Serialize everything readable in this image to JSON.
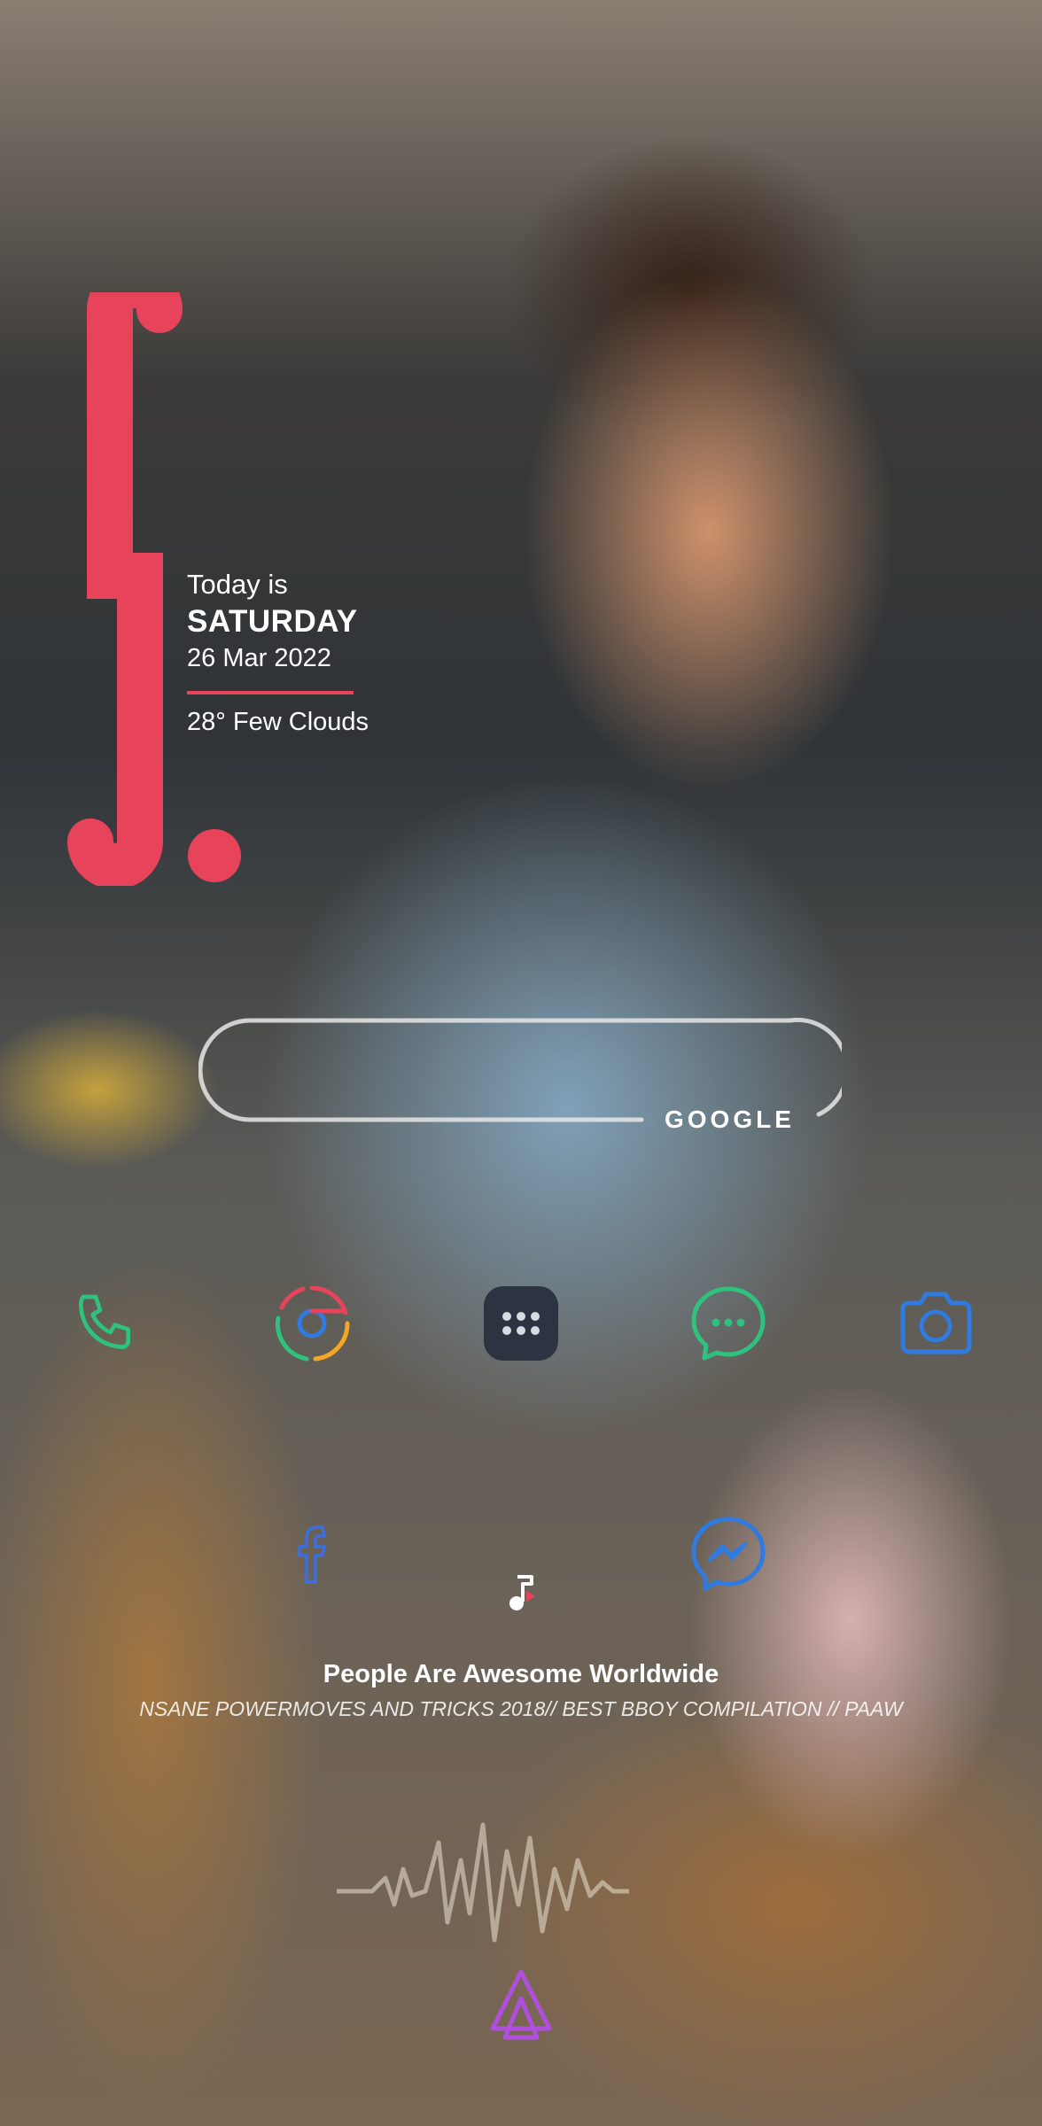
{
  "clock_widget": {
    "logo_letter": "S",
    "today_label": "Today is",
    "day_name": "SATURDAY",
    "date": "26 Mar 2022",
    "weather": "28° Few Clouds"
  },
  "search": {
    "label": "GOOGLE"
  },
  "dock": {
    "row1": [
      {
        "name": "phone-icon",
        "color": "#2ec27e"
      },
      {
        "name": "chrome-icon",
        "color": "#e7435a"
      },
      {
        "name": "app-drawer-icon",
        "color": "#2b3440"
      },
      {
        "name": "messages-icon",
        "color": "#2ec27e"
      },
      {
        "name": "camera-icon",
        "color": "#2f7be0"
      }
    ],
    "row2": [
      {
        "name": "facebook-icon",
        "color": "#3b6fe0"
      },
      {
        "name": "music-icon",
        "color": "#ffffff"
      },
      {
        "name": "messenger-icon",
        "color": "#2f7be0"
      }
    ]
  },
  "media": {
    "title": "People Are Awesome Worldwide",
    "subtitle": "NSANE POWERMOVES AND TRICKS 2018// BEST BBOY COMPILATION // PAAW"
  },
  "colors": {
    "accent": "#e7435a",
    "text": "#ffffff"
  }
}
